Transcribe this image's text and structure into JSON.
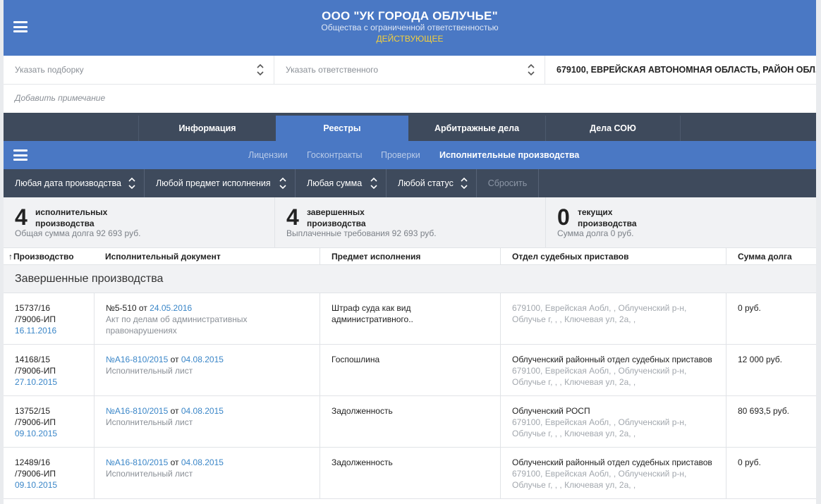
{
  "header": {
    "company_name": "ООО \"УК ГОРОДА ОБЛУЧЬЕ\"",
    "company_type": "Общества с ограниченной ответственностью",
    "status": "ДЕЙСТВУЮЩЕЕ"
  },
  "selectors": {
    "collection_placeholder": "Указать подборку",
    "responsible_placeholder": "Указать ответственного",
    "address": "679100, ЕВРЕЙСКАЯ АВТОНОМНАЯ ОБЛАСТЬ, РАЙОН ОБЛ..."
  },
  "note_placeholder": "Добавить примечание",
  "tabs": [
    {
      "label": "Информация"
    },
    {
      "label": "Реестры"
    },
    {
      "label": "Арбитражные дела"
    },
    {
      "label": "Дела СОЮ"
    }
  ],
  "subnav": [
    {
      "label": "Лицензии"
    },
    {
      "label": "Госконтракты"
    },
    {
      "label": "Проверки"
    },
    {
      "label": "Исполнительные производства"
    }
  ],
  "filters": [
    {
      "label": "Любая дата производства"
    },
    {
      "label": "Любой предмет исполнения"
    },
    {
      "label": "Любая сумма"
    },
    {
      "label": "Любой статус"
    },
    {
      "label": "Сбросить"
    }
  ],
  "summary": [
    {
      "count": "4",
      "label": "исполнительных производства",
      "detail": "Общая сумма долга 92 693 руб."
    },
    {
      "count": "4",
      "label": "завершенных производства",
      "detail": "Выплаченные требования 92 693 руб."
    },
    {
      "count": "0",
      "label": "текущих производства",
      "detail": "Сумма долга 0 руб."
    }
  ],
  "table": {
    "sort_icon": "↑",
    "columns": [
      "Производство",
      "Исполнительный документ",
      "Предмет исполнения",
      "Отдел судебных приставов",
      "Сумма долга"
    ],
    "group_title": "Завершенные производства",
    "rows": [
      {
        "number_line1": "15737/16",
        "number_line2": "/79006-ИП",
        "date": "16.11.2016",
        "doc_number": "№5-510",
        "doc_from": "от",
        "doc_date": "24.05.2016",
        "doc_type": "Акт по делам об административных правонарушениях",
        "subject": "Штраф суда как вид административного..",
        "dept_name": "",
        "dept_address_line1": "679100, Еврейская Аобл, , Облученский р-н,",
        "dept_address_line2": "Облучье г, , , Ключевая ул, 2а, ,",
        "amount": "0 руб."
      },
      {
        "number_line1": "14168/15",
        "number_line2": "/79006-ИП",
        "date": "27.10.2015",
        "doc_number": "№А16-810/2015",
        "doc_from": "от",
        "doc_date": "04.08.2015",
        "doc_type": "Исполнительный лист",
        "subject": "Госпошлина",
        "dept_name": "Облученский районный отдел судебных приставов",
        "dept_address_line1": "679100, Еврейская Аобл, , Облученский р-н,",
        "dept_address_line2": "Облучье г, , , Ключевая ул, 2а, ,",
        "amount": "12 000 руб."
      },
      {
        "number_line1": "13752/15",
        "number_line2": "/79006-ИП",
        "date": "09.10.2015",
        "doc_number": "№А16-810/2015",
        "doc_from": "от",
        "doc_date": "04.08.2015",
        "doc_type": "Исполнительный лист",
        "subject": "Задолженность",
        "dept_name": "Облученский РОСП",
        "dept_address_line1": "679100, Еврейская Аобл, , Облученский р-н,",
        "dept_address_line2": "Облучье г, , , Ключевая ул, 2а, ,",
        "amount": "80 693,5 руб."
      },
      {
        "number_line1": "12489/16",
        "number_line2": "/79006-ИП",
        "date": "09.10.2015",
        "doc_number": "№А16-810/2015",
        "doc_from": "от",
        "doc_date": "04.08.2015",
        "doc_type": "Исполнительный лист",
        "subject": "Задолженность",
        "dept_name": "Облученский районный отдел судебных приставов",
        "dept_address_line1": "679100, Еврейская Аобл, , Облученский р-н,",
        "dept_address_line2": "Облучье г, , , Ключевая ул, 2а, ,",
        "amount": "0 руб."
      }
    ]
  },
  "colors": {
    "primary_blue": "#4a78c4",
    "dark_nav": "#3e4a5c",
    "status_yellow": "#f3cf3d",
    "link_blue": "#3a86c8"
  }
}
